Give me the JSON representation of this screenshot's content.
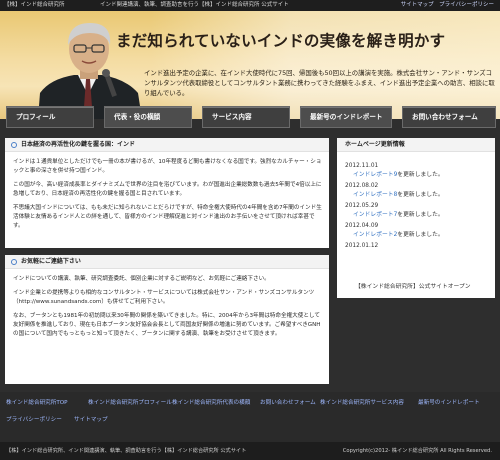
{
  "topbar": {
    "site": "【株】インド総合研究所",
    "desc": "インド関連講演、執筆、調査助言を行う【株】インド総合研究所 公式サイト",
    "links": "サイトマップ　プライバシーポリシー"
  },
  "hero": {
    "headline": "まだ知られていないインドの実像を解き明かす",
    "tagline": "インド進出予定の企業に、在インド大使時代に75回、帰国後も50回以上の講演を実施。株式会社サン・アンド・サンズコンサルタンツ代表取締役としてコンサルタント業務に携わってきた経験をふまえ、インド進出予定企業への助言、相談に取り組んでいる。"
  },
  "nav": [
    "プロフィール",
    "代表・役の横顔",
    "サービス内容",
    "最新号のインドレポート",
    "お問い合わせフォーム"
  ],
  "main": {
    "panel1": {
      "title": "日本経済の再活性化の鍵を握る国：インド",
      "paragraphs": [
        "インドは１通貨単位としただけでも一冊の本が書けるが、10年程度るど間も書けなくなる国です。強烈なカルチャー・ショックと事の深さを併せ持つ国インド。",
        "この国が今、高い経済成長率とダイナミズムで世界の注目を浴びています。わが国進出企業総数数も過去5年間で4倍以上に急増しており、日本経済の再活性化の鍵を握る国と目されています。",
        "不思議大国インドについては、もも未だに知られないことだらけですが、特命全権大使時代の4年間を含め7年間のインド生活体験と友情あるインド人との絆を通して、皆様方のインド理解促進と対インド進出のお手伝いをさせて頂ければ幸甚です。"
      ]
    },
    "panel2": {
      "title": "お気軽にご連絡下さい",
      "paragraphs": [
        "インドについての講演、執筆、研究調査委託、個別企業に対するご説明など、お気軽にご連絡下さい。",
        "インド企業との提携等よりも相的なコンサルタント・サービスについては株式会社サン・アンド・サンズコンサルタンツ（http://www.sunandsands.com）も併せてご利用下さい。",
        "なお、ブータンとも1981年の初訪問以来30年間の関係を築いてきました。特に、2004年から3年間は特命全権大使として友好関係を推進しており、現在も日本ブータン友好協会会長として両国友好関係の増進に努めています。ご希望すべきGNHの国について国内でもっともっと知って頂きたく、ブータンに関する講演、執筆をお受けさせて頂きます。"
      ]
    }
  },
  "sidebar": {
    "title": "ホームページ更新情報",
    "entries": [
      {
        "date": "2012.11.01",
        "link": "インドレポート9",
        "rest": "を更新しました。"
      },
      {
        "date": "2012.08.02",
        "link": "インドレポート8",
        "rest": "を更新しました。"
      },
      {
        "date": "2012.05.29",
        "link": "インドレポート7",
        "rest": "を更新しました。"
      },
      {
        "date": "2012.04.09",
        "link": "インドレポート2",
        "rest": "を更新しました。"
      },
      {
        "date": "2012.01.12",
        "link": "",
        "rest": ""
      }
    ],
    "footer_note": "【株インド総合研究所】公式サイトオープン"
  },
  "footer": {
    "links": [
      "株インド総合研究所TOP",
      "株インド総合研究所プロフィール",
      "株インド総合研究所代表の横顔",
      "お問い合わせフォーム",
      "株インド総合研究所サービス内容",
      "最新号のインドレポート",
      "プライバシーポリシー",
      "サイトマップ"
    ],
    "bottom_left": "【株】インド総合研究所、インド関連講演、執筆、調査助言を行う【株】インド総合研究所 公式サイト",
    "copyright": "Copyright(c)2012- 株インド総合研究所 All Rights Reserved."
  },
  "colors": {
    "accent": "#2f6fc0",
    "hero_gold": "#f1d68f",
    "nav_gray": "#4d4d4d"
  }
}
